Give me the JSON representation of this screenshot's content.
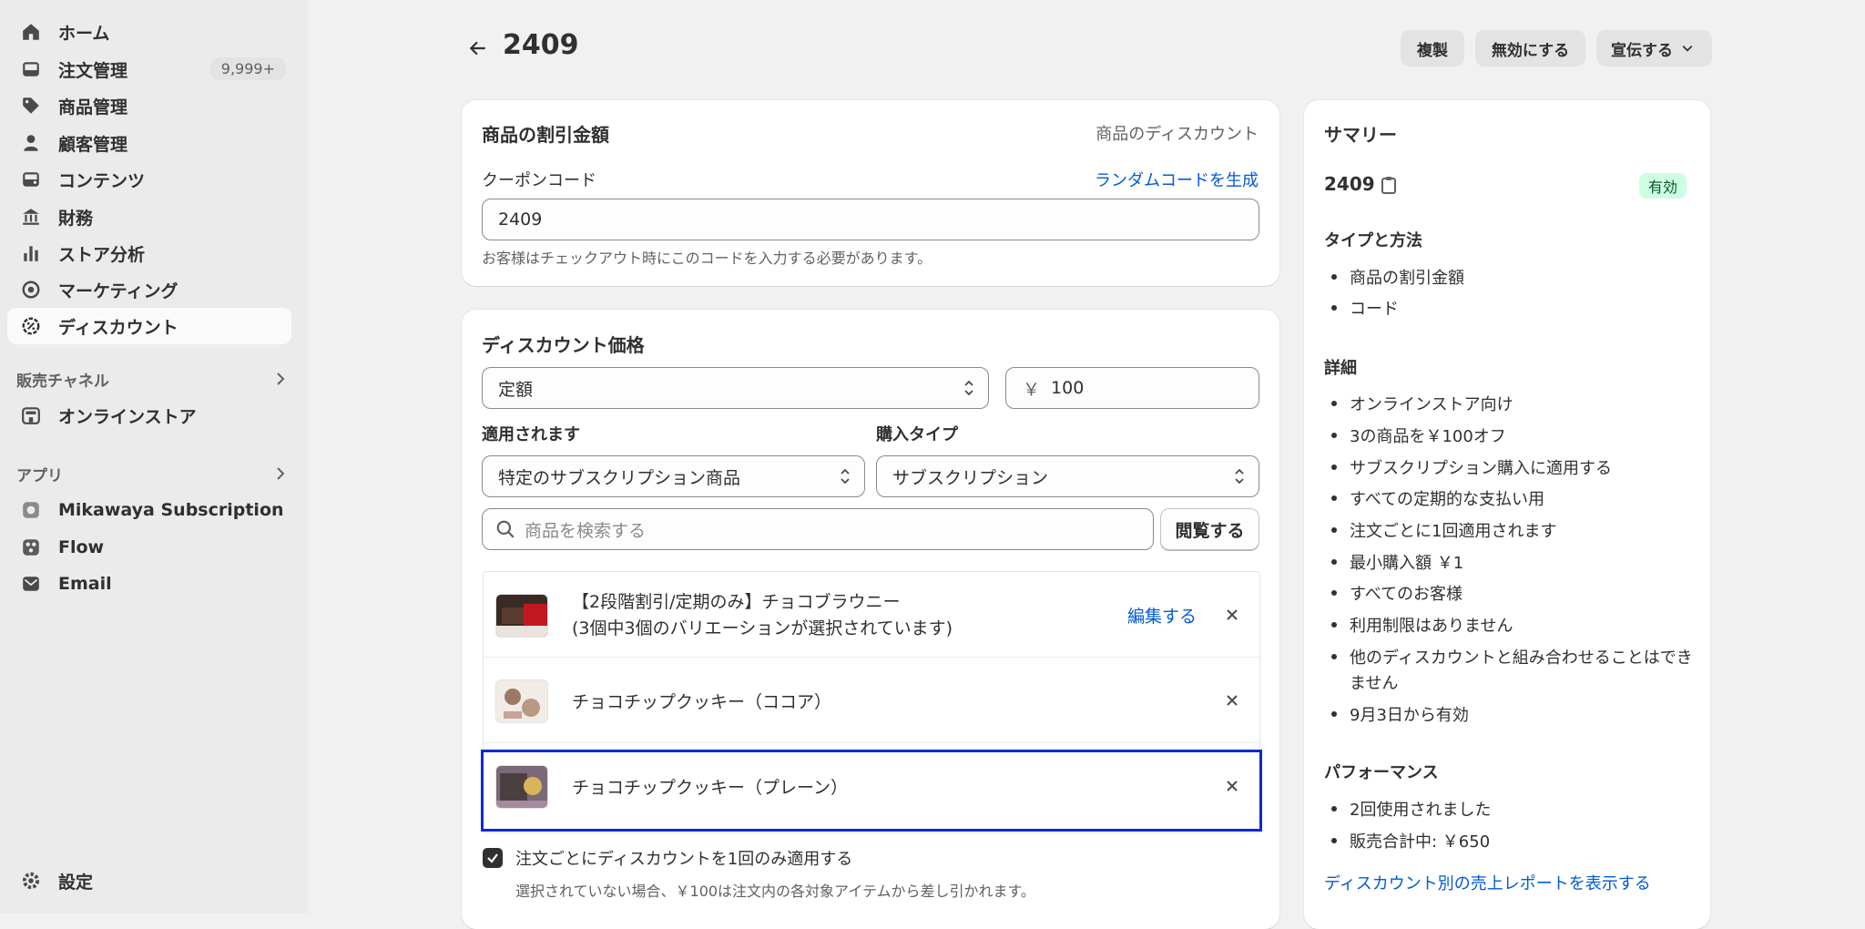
{
  "sidebar": {
    "items": [
      {
        "label": "ホーム",
        "icon": "home-icon"
      },
      {
        "label": "注文管理",
        "icon": "inbox-icon",
        "badge": "9,999+"
      },
      {
        "label": "商品管理",
        "icon": "tag-icon"
      },
      {
        "label": "顧客管理",
        "icon": "person-icon"
      },
      {
        "label": "コンテンツ",
        "icon": "image-icon"
      },
      {
        "label": "財務",
        "icon": "bank-icon"
      },
      {
        "label": "ストア分析",
        "icon": "bar-chart-icon"
      },
      {
        "label": "マーケティング",
        "icon": "target-icon"
      },
      {
        "label": "ディスカウント",
        "icon": "discount-icon"
      }
    ],
    "sales_channels_label": "販売チャネル",
    "online_store_label": "オンラインストア",
    "apps_label": "アプリ",
    "apps": [
      {
        "label": "Mikawaya Subscription",
        "icon": "app-icon"
      },
      {
        "label": "Flow",
        "icon": "flow-icon"
      },
      {
        "label": "Email",
        "icon": "email-icon"
      }
    ],
    "settings_label": "設定"
  },
  "header": {
    "title": "2409",
    "duplicate_label": "複製",
    "deactivate_label": "無効にする",
    "promote_label": "宣伝する"
  },
  "code_card": {
    "title": "商品の割引金額",
    "type_label": "商品のディスカウント",
    "coupon_label": "クーポンコード",
    "generate_label": "ランダムコードを生成",
    "code_value": "2409",
    "help_text": "お客様はチェックアウト時にこのコードを入力する必要があります。"
  },
  "value_card": {
    "title": "ディスカウント価格",
    "value_type": "定額",
    "currency": "￥",
    "amount": "100",
    "applies_label": "適用されます",
    "applies_value": "特定のサブスクリプション商品",
    "purchase_type_label": "購入タイプ",
    "purchase_type_value": "サブスクリプション",
    "search_placeholder": "商品を検索する",
    "browse_label": "閲覧する",
    "products": [
      {
        "name": "【2段階割引/定期のみ】チョコブラウニー",
        "variants": "(3個中3個のバリエーションが選択されています)",
        "edit_label": "編集する"
      },
      {
        "name": "チョコチップクッキー（ココア）"
      },
      {
        "name": "チョコチップクッキー（プレーン）"
      }
    ],
    "once_per_order_label": "注文ごとにディスカウントを1回のみ適用する",
    "once_per_order_help": "選択されていない場合、￥100は注文内の各対象アイテムから差し引かれます。"
  },
  "summary": {
    "title": "サマリー",
    "code": "2409",
    "status": "有効",
    "type_heading": "タイプと方法",
    "type_items": [
      "商品の割引金額",
      "コード"
    ],
    "details_heading": "詳細",
    "details_items": [
      "オンラインストア向け",
      "3の商品を￥100オフ",
      "サブスクリプション購入に適用する",
      "すべての定期的な支払い用",
      "注文ごとに1回適用されます",
      "最小購入額 ￥1",
      "すべてのお客様",
      "利用制限はありません",
      "他のディスカウントと組み合わせることはでき",
      "ません",
      "9月3日から有効"
    ],
    "performance_heading": "パフォーマンス",
    "performance_items": [
      "2回使用されました",
      "販売合計中: ￥650"
    ],
    "report_link": "ディスカウント別の売上レポートを表示する"
  },
  "colors": {
    "accent": "#005bd3",
    "focus": "#0a2ad6",
    "badge_bg": "#cdfee1",
    "badge_text": "#0c5132"
  }
}
